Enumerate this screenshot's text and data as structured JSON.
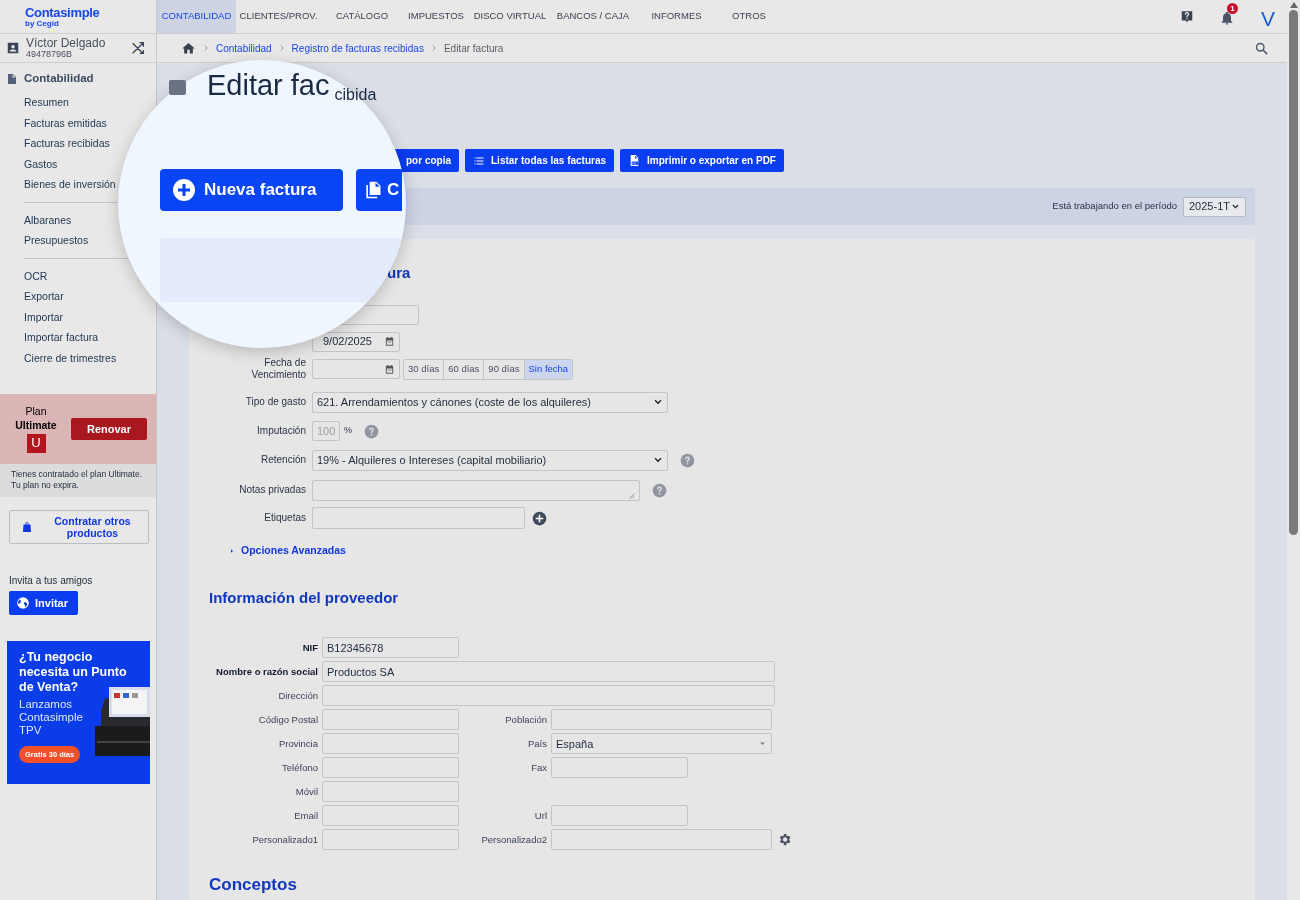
{
  "header": {
    "logo": "Contasimple",
    "logo_sub": "by Cegid",
    "notification_count": "1",
    "avatar": "V",
    "nav": [
      {
        "label": "CONTABILIDAD",
        "selected": true
      },
      {
        "label": "CLIENTES/PROV.",
        "selected": false
      },
      {
        "label": "CATÁLOGO",
        "selected": false
      },
      {
        "label": "IMPUESTOS",
        "selected": false
      },
      {
        "label": "DISCO VIRTUAL",
        "selected": false
      },
      {
        "label": "BANCOS / CAJA",
        "selected": false
      },
      {
        "label": "INFORMES",
        "selected": false
      },
      {
        "label": "OTROS",
        "selected": false
      }
    ]
  },
  "user": {
    "name": "Víctor Delgado",
    "id": "49478796B"
  },
  "breadcrumb": [
    "Contabilidad",
    "Registro de facturas recibidas",
    "Editar factura"
  ],
  "sidebar": {
    "section": "Contabilidad",
    "groups": [
      [
        "Resumen",
        "Facturas emitidas",
        "Facturas recibidas",
        "Gastos",
        "Bienes de inversión"
      ],
      [
        "Albaranes",
        "Presupuestos"
      ],
      [
        "OCR",
        "Exportar",
        "Importar",
        "Importar factura",
        "Cierre de trimestres"
      ]
    ]
  },
  "plan": {
    "label": "Plan",
    "name": "Ultimate",
    "badge": "U",
    "button": "Renovar",
    "note": "Tienes contratado el plan Ultimate. Tu plan no expira."
  },
  "other_products_button": "Contratar otros productos",
  "invite": {
    "text": "Invita a tus amigos",
    "button": "Invitar"
  },
  "ad": {
    "headline": "¿Tu negocio necesita un Punto de Venta?",
    "body": "Lanzamos Contasimple TPV",
    "cta": "Gratis 30 días"
  },
  "page": {
    "title": "Editar fac",
    "subtitle": "cibida",
    "buttons": [
      {
        "kind": "plain",
        "label": "por copia"
      },
      {
        "kind": "list",
        "label": "Listar todas las facturas"
      },
      {
        "kind": "pdf",
        "label": "Imprimir o exportar en PDF"
      }
    ],
    "period_label": "Está trabajando en el período",
    "period_value": "2025-1T"
  },
  "magnifier": {
    "buttons": [
      {
        "kind": "add",
        "label": "Nueva factura"
      },
      {
        "kind": "copy",
        "label": "C"
      }
    ]
  },
  "invoice_form": {
    "title": "ura",
    "rows": [
      {
        "kind": "text"
      },
      {
        "kind": "date",
        "value": "9/02/2025"
      },
      {
        "kind": "due_date",
        "label": "Fecha de Vencimiento",
        "options": [
          {
            "label": "30 días",
            "selected": false
          },
          {
            "label": "60 días",
            "selected": false
          },
          {
            "label": "90 días",
            "selected": false
          },
          {
            "label": "Sin fecha",
            "selected": true
          }
        ]
      },
      {
        "kind": "select",
        "label": "Tipo de gasto",
        "value": "621. Arrendamientos y cánones (coste de los alquileres)",
        "help": false
      },
      {
        "kind": "percent",
        "label": "Imputación",
        "value": "100",
        "unit": "%",
        "disabled": true,
        "help": true
      },
      {
        "kind": "select",
        "label": "Retención",
        "value": "19% - Alquileres o Intereses (capital mobiliario)",
        "help": true
      },
      {
        "kind": "textarea",
        "label": "Notas privadas",
        "help": true
      },
      {
        "kind": "tags",
        "label": "Etiquetas"
      }
    ],
    "advanced": "Opciones Avanzadas"
  },
  "supplier": {
    "title": "Información del proveedor",
    "rows": [
      [
        {
          "label": "NIF",
          "value": "B12345678",
          "required": true
        }
      ],
      [
        {
          "label": "Nombre o razón social",
          "value": "Productos SA",
          "required": true
        }
      ],
      [
        {
          "label": "Dirección",
          "required": false
        }
      ],
      [
        {
          "label": "Código Postal",
          "required": false
        },
        {
          "label": "Población",
          "required": false
        }
      ],
      [
        {
          "label": "Provincia",
          "required": false
        },
        {
          "label": "País",
          "value": "España",
          "required": false,
          "kind": "select"
        }
      ],
      [
        {
          "label": "Teléfono",
          "required": false
        },
        {
          "label": "Fax",
          "required": false
        }
      ],
      [
        {
          "label": "Móvil",
          "required": false
        }
      ],
      [
        {
          "label": "Email",
          "required": false
        },
        {
          "label": "Url",
          "required": false
        }
      ],
      [
        {
          "label": "Personalizado1",
          "required": false
        },
        {
          "label": "Personalizado2",
          "required": false,
          "settings": true
        }
      ]
    ]
  },
  "concepts_title": "Conceptos"
}
